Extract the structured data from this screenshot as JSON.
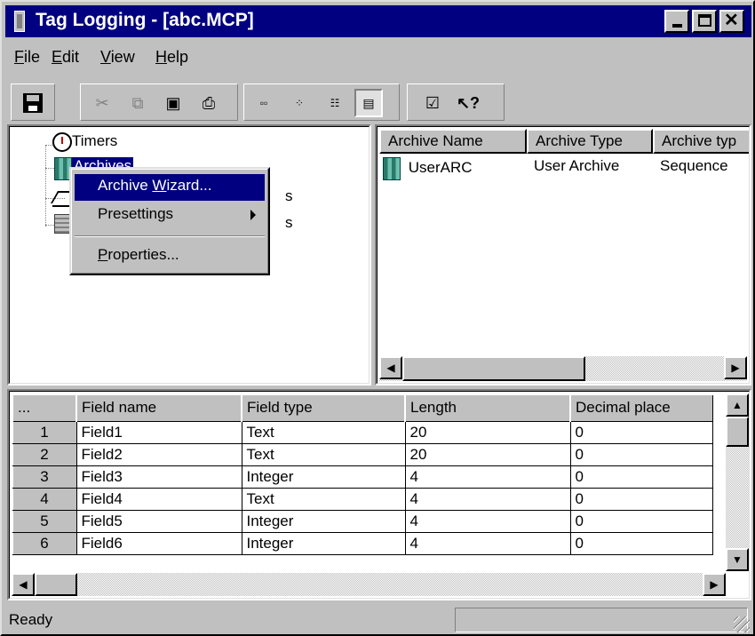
{
  "window": {
    "title": "Tag Logging - [abc.MCP]"
  },
  "menu": [
    {
      "label": "File",
      "ul": "F",
      "rest": "ile"
    },
    {
      "label": "Edit",
      "ul": "E",
      "rest": "dit"
    },
    {
      "label": "View",
      "ul": "V",
      "rest": "iew"
    },
    {
      "label": "Help",
      "ul": "H",
      "rest": "elp"
    }
  ],
  "toolbar": {
    "buttons": [
      "save-icon",
      "cut-icon",
      "copy-icon",
      "paste-icon",
      "print-icon",
      "large-icons-icon",
      "small-icons-icon",
      "list-icon",
      "details-icon",
      "properties-icon",
      "context-help-icon"
    ]
  },
  "tree": {
    "items": [
      {
        "label": "Timers"
      },
      {
        "label": "Archives"
      },
      {
        "label": "s"
      },
      {
        "label": "s"
      }
    ]
  },
  "archive_list": {
    "columns": [
      "Archive Name",
      "Archive Type",
      "Archive typ"
    ],
    "rows": [
      {
        "name": "UserARC",
        "type": "User Archive",
        "subtype": "Sequence"
      }
    ]
  },
  "context_menu": {
    "items": [
      {
        "pre": "Archive ",
        "ul": "W",
        "post": "izard..."
      },
      {
        "pre": "Presettings",
        "ul": "",
        "post": ""
      },
      {
        "pre": "",
        "ul": "P",
        "post": "roperties..."
      }
    ]
  },
  "fields_table": {
    "corner": "...",
    "columns": [
      "Field name",
      "Field type",
      "Length",
      "Decimal place"
    ],
    "rows": [
      {
        "n": "1",
        "name": "Field1",
        "type": "Text",
        "length": "20",
        "decimal": "0"
      },
      {
        "n": "2",
        "name": "Field2",
        "type": "Text",
        "length": "20",
        "decimal": "0"
      },
      {
        "n": "3",
        "name": "Field3",
        "type": "Integer",
        "length": "4",
        "decimal": "0"
      },
      {
        "n": "4",
        "name": "Field4",
        "type": "Text",
        "length": "4",
        "decimal": "0"
      },
      {
        "n": "5",
        "name": "Field5",
        "type": "Integer",
        "length": "4",
        "decimal": "0"
      },
      {
        "n": "6",
        "name": "Field6",
        "type": "Integer",
        "length": "4",
        "decimal": "0"
      }
    ]
  },
  "status": {
    "text": "Ready"
  },
  "colors": {
    "face": "#c0c0c0",
    "titlebar": "#000080",
    "selection": "#000080"
  }
}
